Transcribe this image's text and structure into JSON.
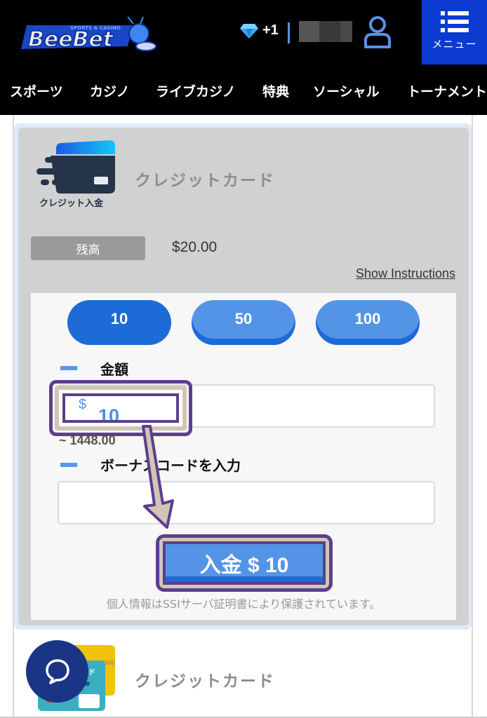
{
  "header": {
    "logo_text": "BeeBet",
    "logo_tagline": "SPORTS & CASINO",
    "gem_count": "+1",
    "menu_label": "メニュー"
  },
  "nav": {
    "items": [
      {
        "label": "スポーツ"
      },
      {
        "label": "カジノ"
      },
      {
        "label": "ライブカジノ"
      },
      {
        "label": "特典"
      },
      {
        "label": "ソーシャル"
      },
      {
        "label": "トーナメント"
      }
    ]
  },
  "payment": {
    "logo_caption": "クレジット入金",
    "title": "クレジットカード",
    "balance_label": "残高",
    "balance_value": "$20.00",
    "show_instructions": "Show Instructions",
    "amount_options": [
      {
        "label": "10",
        "selected": true
      },
      {
        "label": "50",
        "selected": false
      },
      {
        "label": "100",
        "selected": false
      }
    ],
    "amount_label": "金額",
    "currency_symbol": "$",
    "amount_value": "10",
    "approx_value": "~ 1448.00",
    "bonus_label": "ボーナスコードを入力",
    "bonus_value": "",
    "deposit_button": "入金 $ 10",
    "secure_note": "個人情報はSSIサーバ証明書により保護されています。"
  },
  "next_method": {
    "title": "クレジットカード",
    "card_text": "ード"
  },
  "colors": {
    "accent_blue": "#1c6bd6",
    "light_blue": "#5494e6",
    "menu_blue": "#0b3bd1",
    "annotation_purple": "#5b3f8c",
    "annotation_tan": "#d1c6b6",
    "chat_navy": "#1a3585"
  }
}
